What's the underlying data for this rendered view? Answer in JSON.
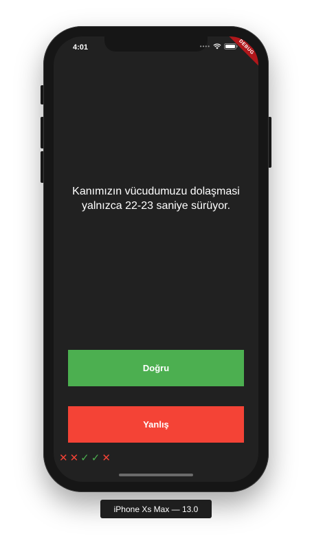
{
  "status_bar": {
    "time": "4:01",
    "signal_icon": "signal-dots-icon",
    "wifi_icon": "wifi-icon",
    "battery_icon": "battery-icon"
  },
  "debug_banner": "DEBUG",
  "question": {
    "text": "Kanımızın vücudumuzu dolaşmasi yalnızca 22-23 saniye sürüyor."
  },
  "buttons": {
    "true_label": "Doğru",
    "false_label": "Yanlış",
    "true_color": "#4caf50",
    "false_color": "#f44336"
  },
  "score_keeper": [
    {
      "result": "wrong",
      "icon": "close-icon",
      "glyph": "✕"
    },
    {
      "result": "wrong",
      "icon": "close-icon",
      "glyph": "✕"
    },
    {
      "result": "right",
      "icon": "check-icon",
      "glyph": "✓"
    },
    {
      "result": "right",
      "icon": "check-icon",
      "glyph": "✓"
    },
    {
      "result": "wrong",
      "icon": "close-icon",
      "glyph": "✕"
    }
  ],
  "device_label": "iPhone Xs Max — 13.0",
  "colors": {
    "screen_background": "#212121",
    "correct": "#4caf50",
    "incorrect": "#f44336"
  }
}
